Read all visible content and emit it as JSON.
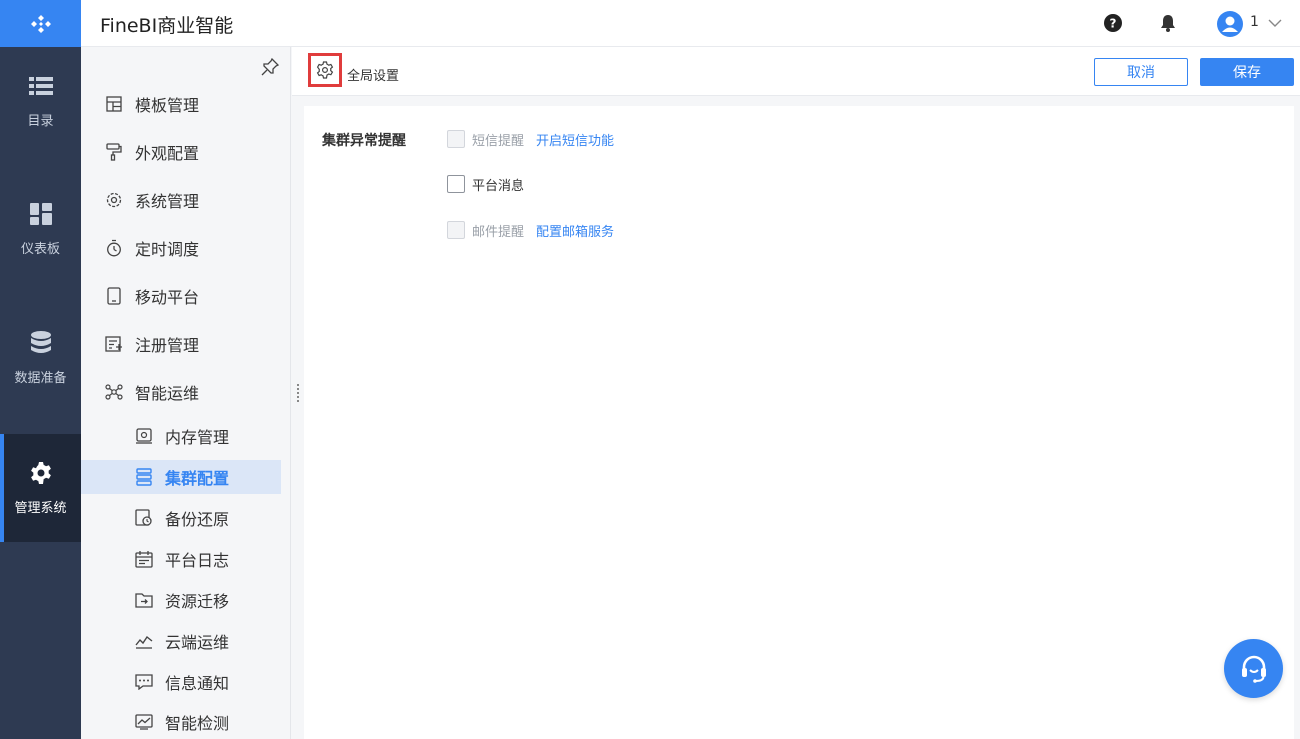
{
  "app": {
    "title": "FineBI商业智能"
  },
  "header": {
    "user_name": "1"
  },
  "rail": {
    "items": [
      {
        "label": "目录",
        "icon": "list-icon"
      },
      {
        "label": "仪表板",
        "icon": "dashboard-grid-icon"
      },
      {
        "label": "数据准备",
        "icon": "database-icon"
      },
      {
        "label": "管理系统",
        "icon": "gear-icon",
        "active": true
      }
    ]
  },
  "sidebar": {
    "items": [
      {
        "label": "模板管理",
        "icon": "template-icon"
      },
      {
        "label": "外观配置",
        "icon": "paint-roller-icon"
      },
      {
        "label": "系统管理",
        "icon": "gear-icon"
      },
      {
        "label": "定时调度",
        "icon": "timer-icon"
      },
      {
        "label": "移动平台",
        "icon": "mobile-icon"
      },
      {
        "label": "注册管理",
        "icon": "register-icon"
      },
      {
        "label": "智能运维",
        "icon": "network-icon"
      }
    ],
    "sub_items": [
      {
        "label": "内存管理",
        "icon": "memory-icon"
      },
      {
        "label": "集群配置",
        "icon": "cluster-icon",
        "active": true
      },
      {
        "label": "备份还原",
        "icon": "backup-icon"
      },
      {
        "label": "平台日志",
        "icon": "calendar-log-icon"
      },
      {
        "label": "资源迁移",
        "icon": "folder-arrow-icon"
      },
      {
        "label": "云端运维",
        "icon": "cloud-chart-icon"
      },
      {
        "label": "信息通知",
        "icon": "message-icon"
      },
      {
        "label": "智能检测",
        "icon": "monitor-icon"
      }
    ]
  },
  "toolbar": {
    "label": "全局设置",
    "cancel_label": "取消",
    "save_label": "保存"
  },
  "panel": {
    "section_label": "集群异常提醒",
    "options": [
      {
        "label": "短信提醒",
        "link": "开启短信功能",
        "enabled": false,
        "checked": false
      },
      {
        "label": "平台消息",
        "link": "",
        "enabled": true,
        "checked": false
      },
      {
        "label": "邮件提醒",
        "link": "配置邮箱服务",
        "enabled": false,
        "checked": false
      }
    ]
  },
  "colors": {
    "accent": "#3685f2",
    "rail": "#2e3a52",
    "highlight_border": "#e03c3c"
  }
}
